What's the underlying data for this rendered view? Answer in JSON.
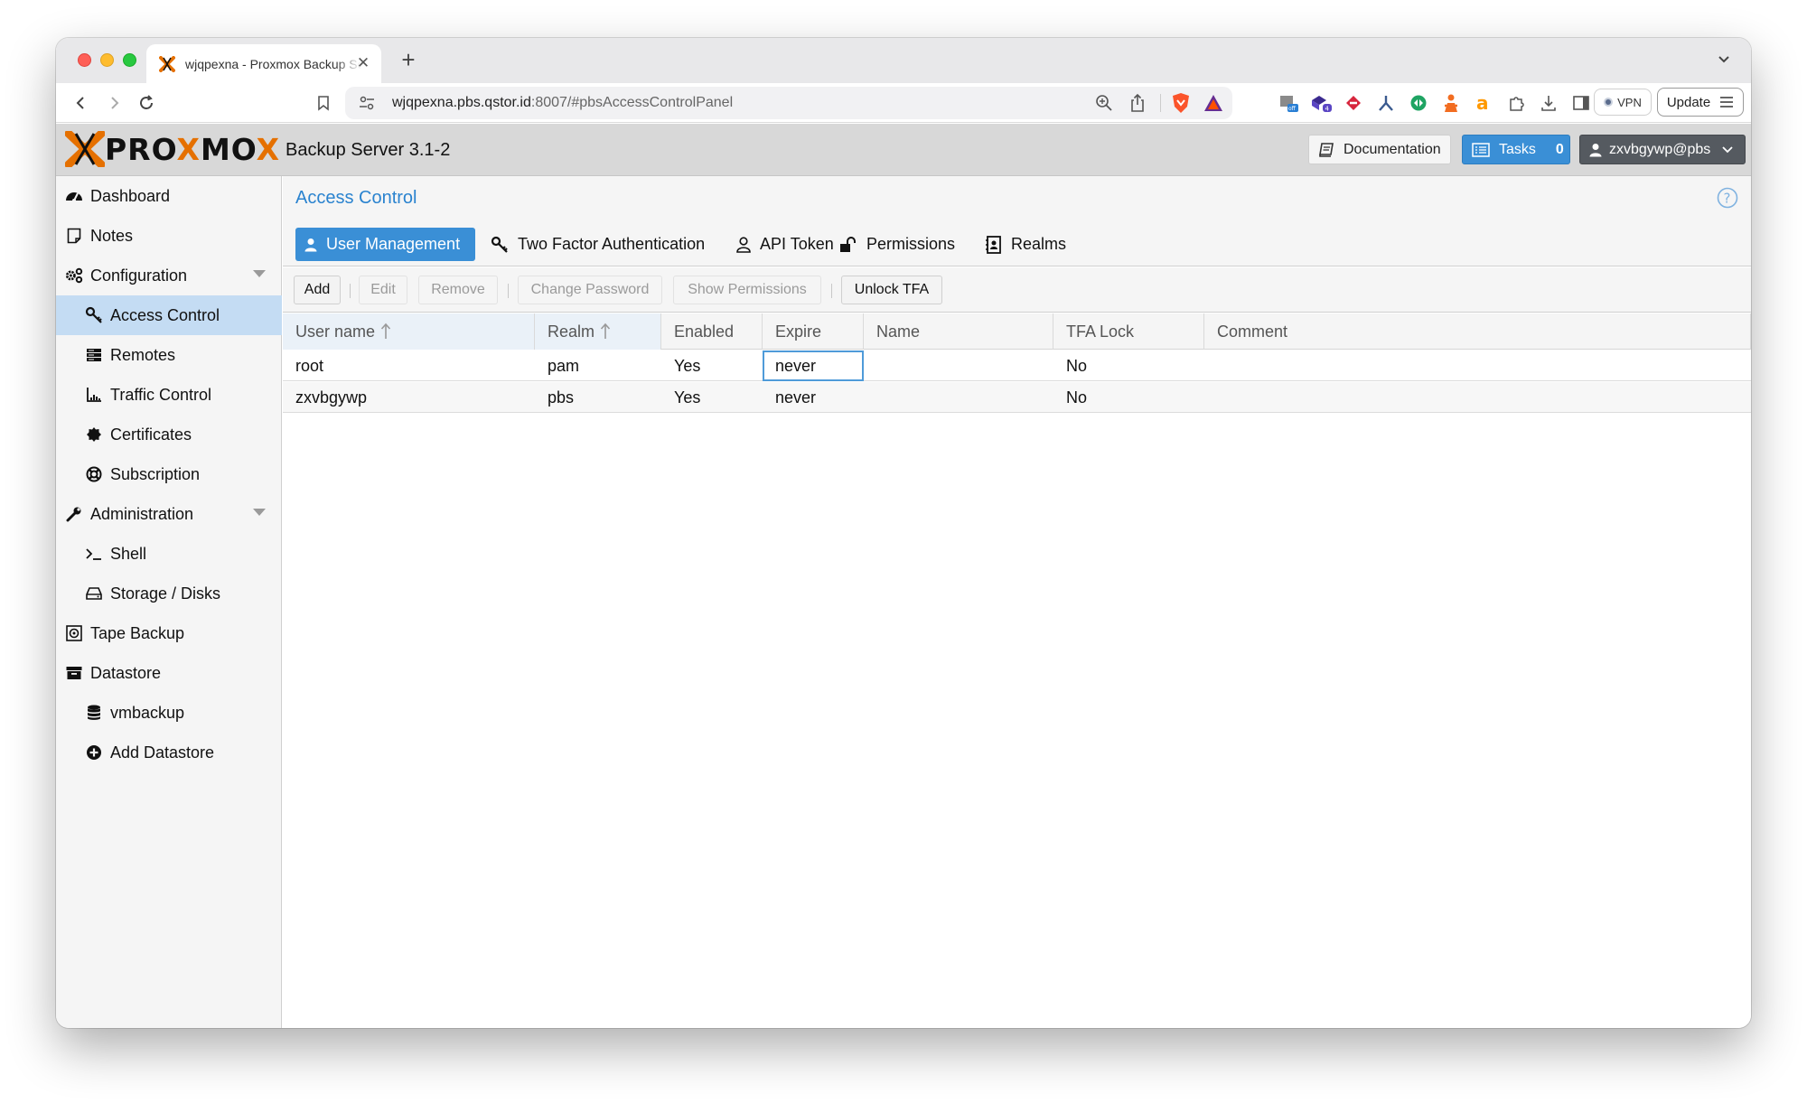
{
  "browser": {
    "tab_title": "wjqpexna - Proxmox Backup Server",
    "url_host": "wjqpexna.pbs.qstor.id",
    "url_rest": ":8007/#pbsAccessControlPanel",
    "vpn_label": "VPN",
    "update_label": "Update"
  },
  "header": {
    "logo_text_pre": "PRO",
    "logo_text_x": "X",
    "logo_text_post": "MO",
    "logo_text_end": "X",
    "product": "Backup Server 3.1-2",
    "documentation": "Documentation",
    "tasks": "Tasks",
    "tasks_count": "0",
    "user": "zxvbgywp@pbs"
  },
  "sidebar": {
    "items": [
      {
        "label": "Dashboard",
        "icon": "tachometer-icon"
      },
      {
        "label": "Notes",
        "icon": "note-icon"
      },
      {
        "label": "Configuration",
        "icon": "gears-icon"
      },
      {
        "label": "Access Control",
        "icon": "key-icon"
      },
      {
        "label": "Remotes",
        "icon": "server-icon"
      },
      {
        "label": "Traffic Control",
        "icon": "chart-icon"
      },
      {
        "label": "Certificates",
        "icon": "certificate-icon"
      },
      {
        "label": "Subscription",
        "icon": "support-icon"
      },
      {
        "label": "Administration",
        "icon": "wrench-icon"
      },
      {
        "label": "Shell",
        "icon": "terminal-icon"
      },
      {
        "label": "Storage / Disks",
        "icon": "hdd-icon"
      },
      {
        "label": "Tape Backup",
        "icon": "tape-icon"
      },
      {
        "label": "Datastore",
        "icon": "archive-icon"
      },
      {
        "label": "vmbackup",
        "icon": "database-icon"
      },
      {
        "label": "Add Datastore",
        "icon": "plus-circle-icon"
      }
    ]
  },
  "panel": {
    "title": "Access Control",
    "tabs": [
      "User Management",
      "Two Factor Authentication",
      "API Token",
      "Permissions",
      "Realms"
    ],
    "buttons": {
      "add": "Add",
      "edit": "Edit",
      "remove": "Remove",
      "change_password": "Change Password",
      "show_permissions": "Show Permissions",
      "unlock_tfa": "Unlock TFA"
    }
  },
  "grid": {
    "columns": [
      "User name",
      "Realm",
      "Enabled",
      "Expire",
      "Name",
      "TFA Lock",
      "Comment"
    ],
    "rows": [
      {
        "user": "root",
        "realm": "pam",
        "enabled": "Yes",
        "expire": "never",
        "name": "",
        "tfa": "No",
        "comment": ""
      },
      {
        "user": "zxvbgywp",
        "realm": "pbs",
        "enabled": "Yes",
        "expire": "never",
        "name": "",
        "tfa": "No",
        "comment": ""
      }
    ]
  },
  "colors": {
    "accent": "#3a8fd6",
    "selected_nav": "#c4dcf3",
    "proxmox_orange": "#e57000"
  }
}
